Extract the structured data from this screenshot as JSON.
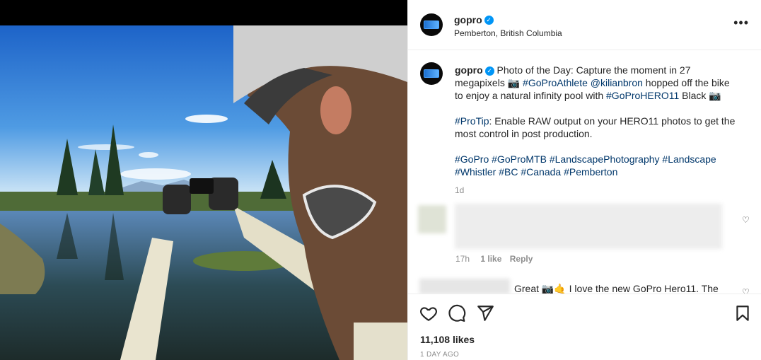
{
  "post": {
    "username": "gopro",
    "location": "Pemberton, British Columbia",
    "caption": {
      "username": "gopro",
      "line1_a": "Photo of the Day: Capture the moment in 27",
      "line2_a": "megapixels ",
      "line2_tag1": "#GoProAthlete",
      "line2_mention": "@kilianbron",
      "line2_b": " hopped off the bike",
      "line3_a": "to enjoy a natural infinity pool with ",
      "line3_tag": "#GoProHERO11",
      "line3_b": " Black",
      "protip_tag": "#ProTip",
      "protip_line1": ": Enable RAW output on your HERO11 photos to get the",
      "protip_line2": "most control in post production.",
      "tags_line1": [
        "#GoPro",
        "#GoProMTB",
        "#LandscapePhotography",
        "#Landscape"
      ],
      "tags_line2": [
        "#Whistler",
        "#BC",
        "#Canada",
        "#Pemberton"
      ],
      "age": "1d"
    },
    "comments": [
      {
        "time": "17h",
        "likes": "1 like",
        "reply": "Reply"
      },
      {
        "visible_text": "Great 📷🤙 I love the new GoPro Hero11. The"
      }
    ],
    "likes": "11,108 likes",
    "date": "1 DAY AGO"
  },
  "icons": {
    "more": "more-options-icon",
    "like": "heart-icon",
    "comment": "comment-icon",
    "share": "share-icon",
    "save": "bookmark-icon",
    "verified": "verified-badge-icon"
  },
  "colors": {
    "link": "#00376b",
    "verified": "#0095f6",
    "muted": "#8e8e8e"
  }
}
